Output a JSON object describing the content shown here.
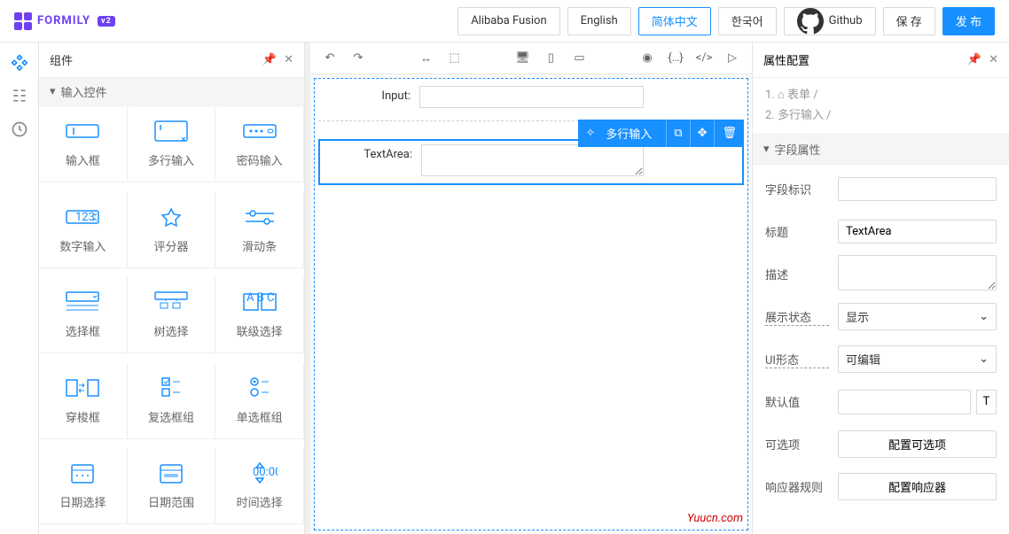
{
  "header": {
    "brand": "FORMILY",
    "badge": "v2",
    "buttons": {
      "fusion": "Alibaba Fusion",
      "english": "English",
      "zh": "简体中文",
      "ko": "한국어",
      "github": "Github",
      "save": "保 存",
      "publish": "发 布"
    }
  },
  "components": {
    "title": "组件",
    "group": "输入控件",
    "items": [
      "输入框",
      "多行输入",
      "密码输入",
      "数字输入",
      "评分器",
      "滑动条",
      "选择框",
      "树选择",
      "联级选择",
      "穿梭框",
      "复选框组",
      "单选框组",
      "日期选择",
      "日期范围",
      "时间选择"
    ]
  },
  "canvas": {
    "input_label": "Input:",
    "textarea_label": "TextArea:",
    "selected_tag": "多行输入"
  },
  "props": {
    "title": "属性配置",
    "crumb1": "1. ⌂ 表单 /",
    "crumb2": "2. 多行输入 /",
    "section": "字段属性",
    "rows": {
      "id": "字段标识",
      "title": "标题",
      "title_val": "TextArea",
      "desc": "描述",
      "display": "展示状态",
      "display_val": "显示",
      "pattern": "UI形态",
      "pattern_val": "可编辑",
      "default": "默认值",
      "enum": "可选项",
      "enum_btn": "配置可选项",
      "reactions": "响应器规则",
      "reactions_btn": "配置响应器"
    }
  },
  "watermark": "Yuucn.com"
}
